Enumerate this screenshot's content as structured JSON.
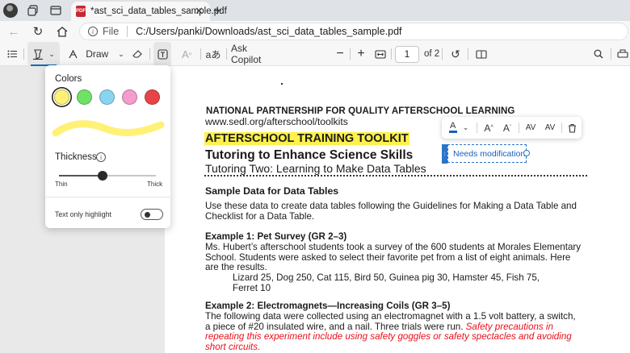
{
  "browser": {
    "tab_title": "*ast_sci_data_tables_sample.pdf",
    "pdf_badge": "PDF",
    "tab_close": "✕",
    "new_tab": "+",
    "address_label": "File",
    "address_path": "C:/Users/panki/Downloads/ast_sci_data_tables_sample.pdf"
  },
  "toolbar": {
    "draw_label": "Draw",
    "read_aloud_label": "aあ",
    "ask_copilot_label": "Ask Copilot",
    "page_number": "1",
    "page_of": "of 2"
  },
  "highlight_panel": {
    "colors_label": "Colors",
    "swatches": [
      {
        "name": "yellow",
        "color": "#fff176"
      },
      {
        "name": "green",
        "color": "#6ee267"
      },
      {
        "name": "blue",
        "color": "#8ad4f3"
      },
      {
        "name": "pink",
        "color": "#f49ccc"
      },
      {
        "name": "red",
        "color": "#e64548"
      }
    ],
    "selected_color": "#fff176",
    "thickness_label": "Thickness",
    "thickness_value": 0.45,
    "thin_label": "Thin",
    "thick_label": "Thick",
    "text_only_label": "Text only highlight",
    "text_only_enabled": false
  },
  "annotation": {
    "text": "Needs modification",
    "color": "#1560bd"
  },
  "document": {
    "org": "NATIONAL PARTNERSHIP FOR QUALITY AFTERSCHOOL LEARNING",
    "url": "www.sedl.org/afterschool/toolkits",
    "toolkit": "AFTERSCHOOL TRAINING TOOLKIT",
    "title": "Tutoring to Enhance Science Skills",
    "subtitle": "Tutoring Two: Learning to Make Data Tables",
    "sample_heading": "Sample Data for Data Tables",
    "intro_line1": "Use these data to create data tables following the Guidelines for Making a Data Table and",
    "intro_line2": "Checklist for a Data Table.",
    "ex1_heading": "Example 1: Pet Survey (GR 2–3)",
    "ex1_line1": "Ms. Hubert’s afterschool students took a survey of the 600 students at Morales Elementary",
    "ex1_line2": "School. Students were asked to select their favorite pet from a list of eight animals. Here",
    "ex1_line3": "are the results.",
    "ex1_data1": "Lizard 25, Dog 250, Cat 115, Bird 50, Guinea pig 30, Hamster 45, Fish 75,",
    "ex1_data2": "Ferret 10",
    "ex2_heading": "Example 2: Electromagnets—Increasing Coils (GR 3–5)",
    "ex2_line1": "The following data were collected using an electromagnet with a 1.5 volt battery, a switch,",
    "ex2_line2a": "a piece of #20 insulated wire, and a nail. Three trials were run. ",
    "ex2_line2b": "Safety precautions in",
    "ex2_line3": "repeating this experiment include using safety goggles or safety spectacles and avoiding",
    "ex2_line4": "short circuits."
  }
}
